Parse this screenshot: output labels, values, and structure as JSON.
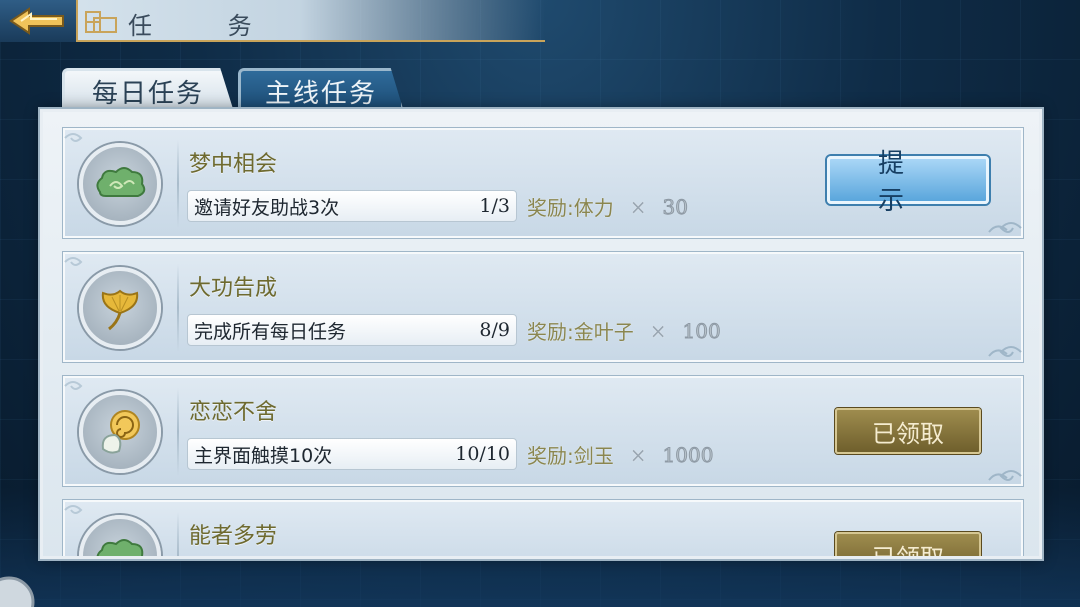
{
  "header": {
    "title": "任 务",
    "back_icon": "back-arrow-icon"
  },
  "tabs": [
    {
      "label": "每日任务",
      "active": true
    },
    {
      "label": "主线任务",
      "active": false
    }
  ],
  "tasks": [
    {
      "icon": "green-cloud-icon",
      "title": "梦中相会",
      "desc": "邀请好友助战3次",
      "progress": "1/3",
      "reward_label": "奖励:",
      "reward_item": "体力",
      "reward_times": "×",
      "reward_amount": "30",
      "button": "提 示"
    },
    {
      "icon": "ginkgo-leaf-icon",
      "title": "大功告成",
      "desc": "完成所有每日任务",
      "progress": "8/9",
      "reward_label": "奖励:",
      "reward_item": "金叶子",
      "reward_times": "×",
      "reward_amount": "100",
      "button": ""
    },
    {
      "icon": "jade-swirl-icon",
      "title": "恋恋不舍",
      "desc": "主界面触摸10次",
      "progress": "10/10",
      "reward_label": "奖励:",
      "reward_item": "剑玉",
      "reward_times": "×",
      "reward_amount": "1000",
      "button": "已领取"
    },
    {
      "icon": "green-cloud-icon",
      "title": "能者多劳",
      "button": "已领取"
    }
  ],
  "colors": {
    "accent_gold": "#c9a45a",
    "hint_blue": "#5aa6dc",
    "claimed_brown": "#6f5f2c"
  }
}
